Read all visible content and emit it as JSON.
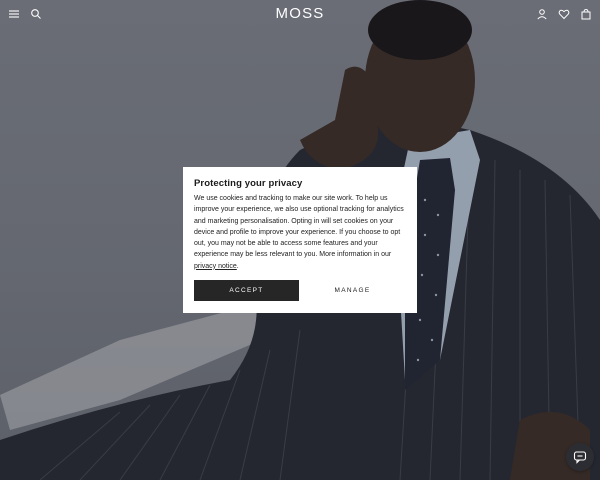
{
  "header": {
    "logo": "MOSS",
    "left_icons": [
      "menu-icon",
      "search-icon"
    ],
    "right_icons": [
      "account-icon",
      "wishlist-icon",
      "bag-icon"
    ]
  },
  "cookie_modal": {
    "title": "Protecting your privacy",
    "body": "We use cookies and tracking to make our site work. To help us improve your experience, we also use optional tracking for analytics and marketing personalisation. Opting in will set cookies on your device and profile to improve your experience. If you choose to opt out, you may not be able to access some features and your experience may be less relevant to you. More information in our ",
    "link_text": "privacy notice",
    "body_end": ".",
    "accept_label": "ACCEPT",
    "manage_label": "MANAGE"
  },
  "colors": {
    "accent_dark": "#262626",
    "header_text": "#ffffff"
  },
  "chat": {
    "icon": "chat-icon"
  }
}
